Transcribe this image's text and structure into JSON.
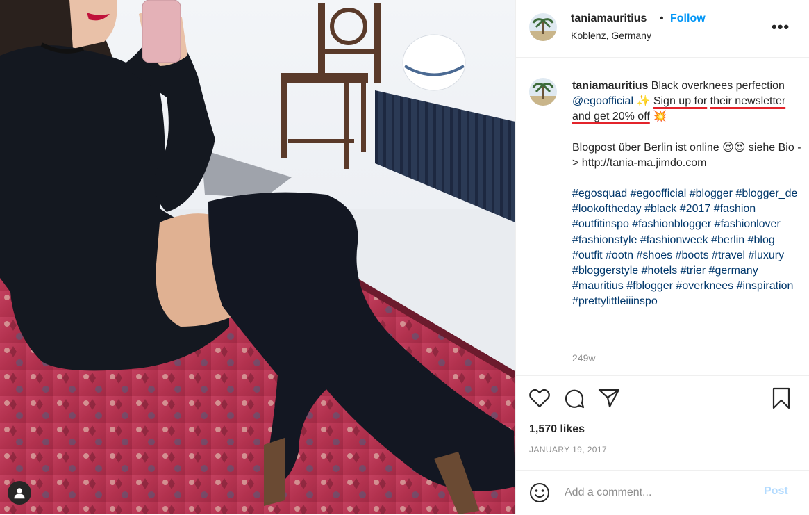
{
  "photo": {
    "alt_icon": "user-icon"
  },
  "header": {
    "username": "taniamauritius",
    "separator": "•",
    "follow_label": "Follow",
    "location": "Koblenz, Germany",
    "more_label": "•••"
  },
  "caption": {
    "username": "taniamauritius",
    "line1_text": " Black overknees perfection ",
    "mention": "@egoofficial",
    "sparkle": " ✨",
    "highlight1": "Sign up for",
    "highlight2": "their newsletter and get 20% off",
    "emoji1": " 💥",
    "para2": "Blogpost über Berlin ist online 😍😍 siehe Bio -> http://tania-ma.jimdo.com",
    "hashtags": "#egosquad #egoofficial #blogger #blogger_de #lookoftheday #black #2017 #fashion #outfitinspo #fashionblogger #fashionlover #fashionstyle #fashionweek #berlin #blog #outfit #ootn #shoes #boots #travel #luxury #bloggerstyle #hotels #trier #germany #mauritius #fblogger #overknees #inspiration #prettylittleiiinspo",
    "time": "249w"
  },
  "actions": {
    "icons": [
      "heart-icon",
      "comment-icon",
      "share-icon",
      "bookmark-icon"
    ],
    "likes": "1,570 likes",
    "date": "JANUARY 19, 2017"
  },
  "comment": {
    "placeholder": "Add a comment...",
    "post_label": "Post"
  },
  "colors": {
    "accent": "#0095f6",
    "link": "#00376b",
    "highlight_underline": "#e3242b",
    "muted": "#8e8e8e",
    "post_disabled": "#b3dbff"
  }
}
